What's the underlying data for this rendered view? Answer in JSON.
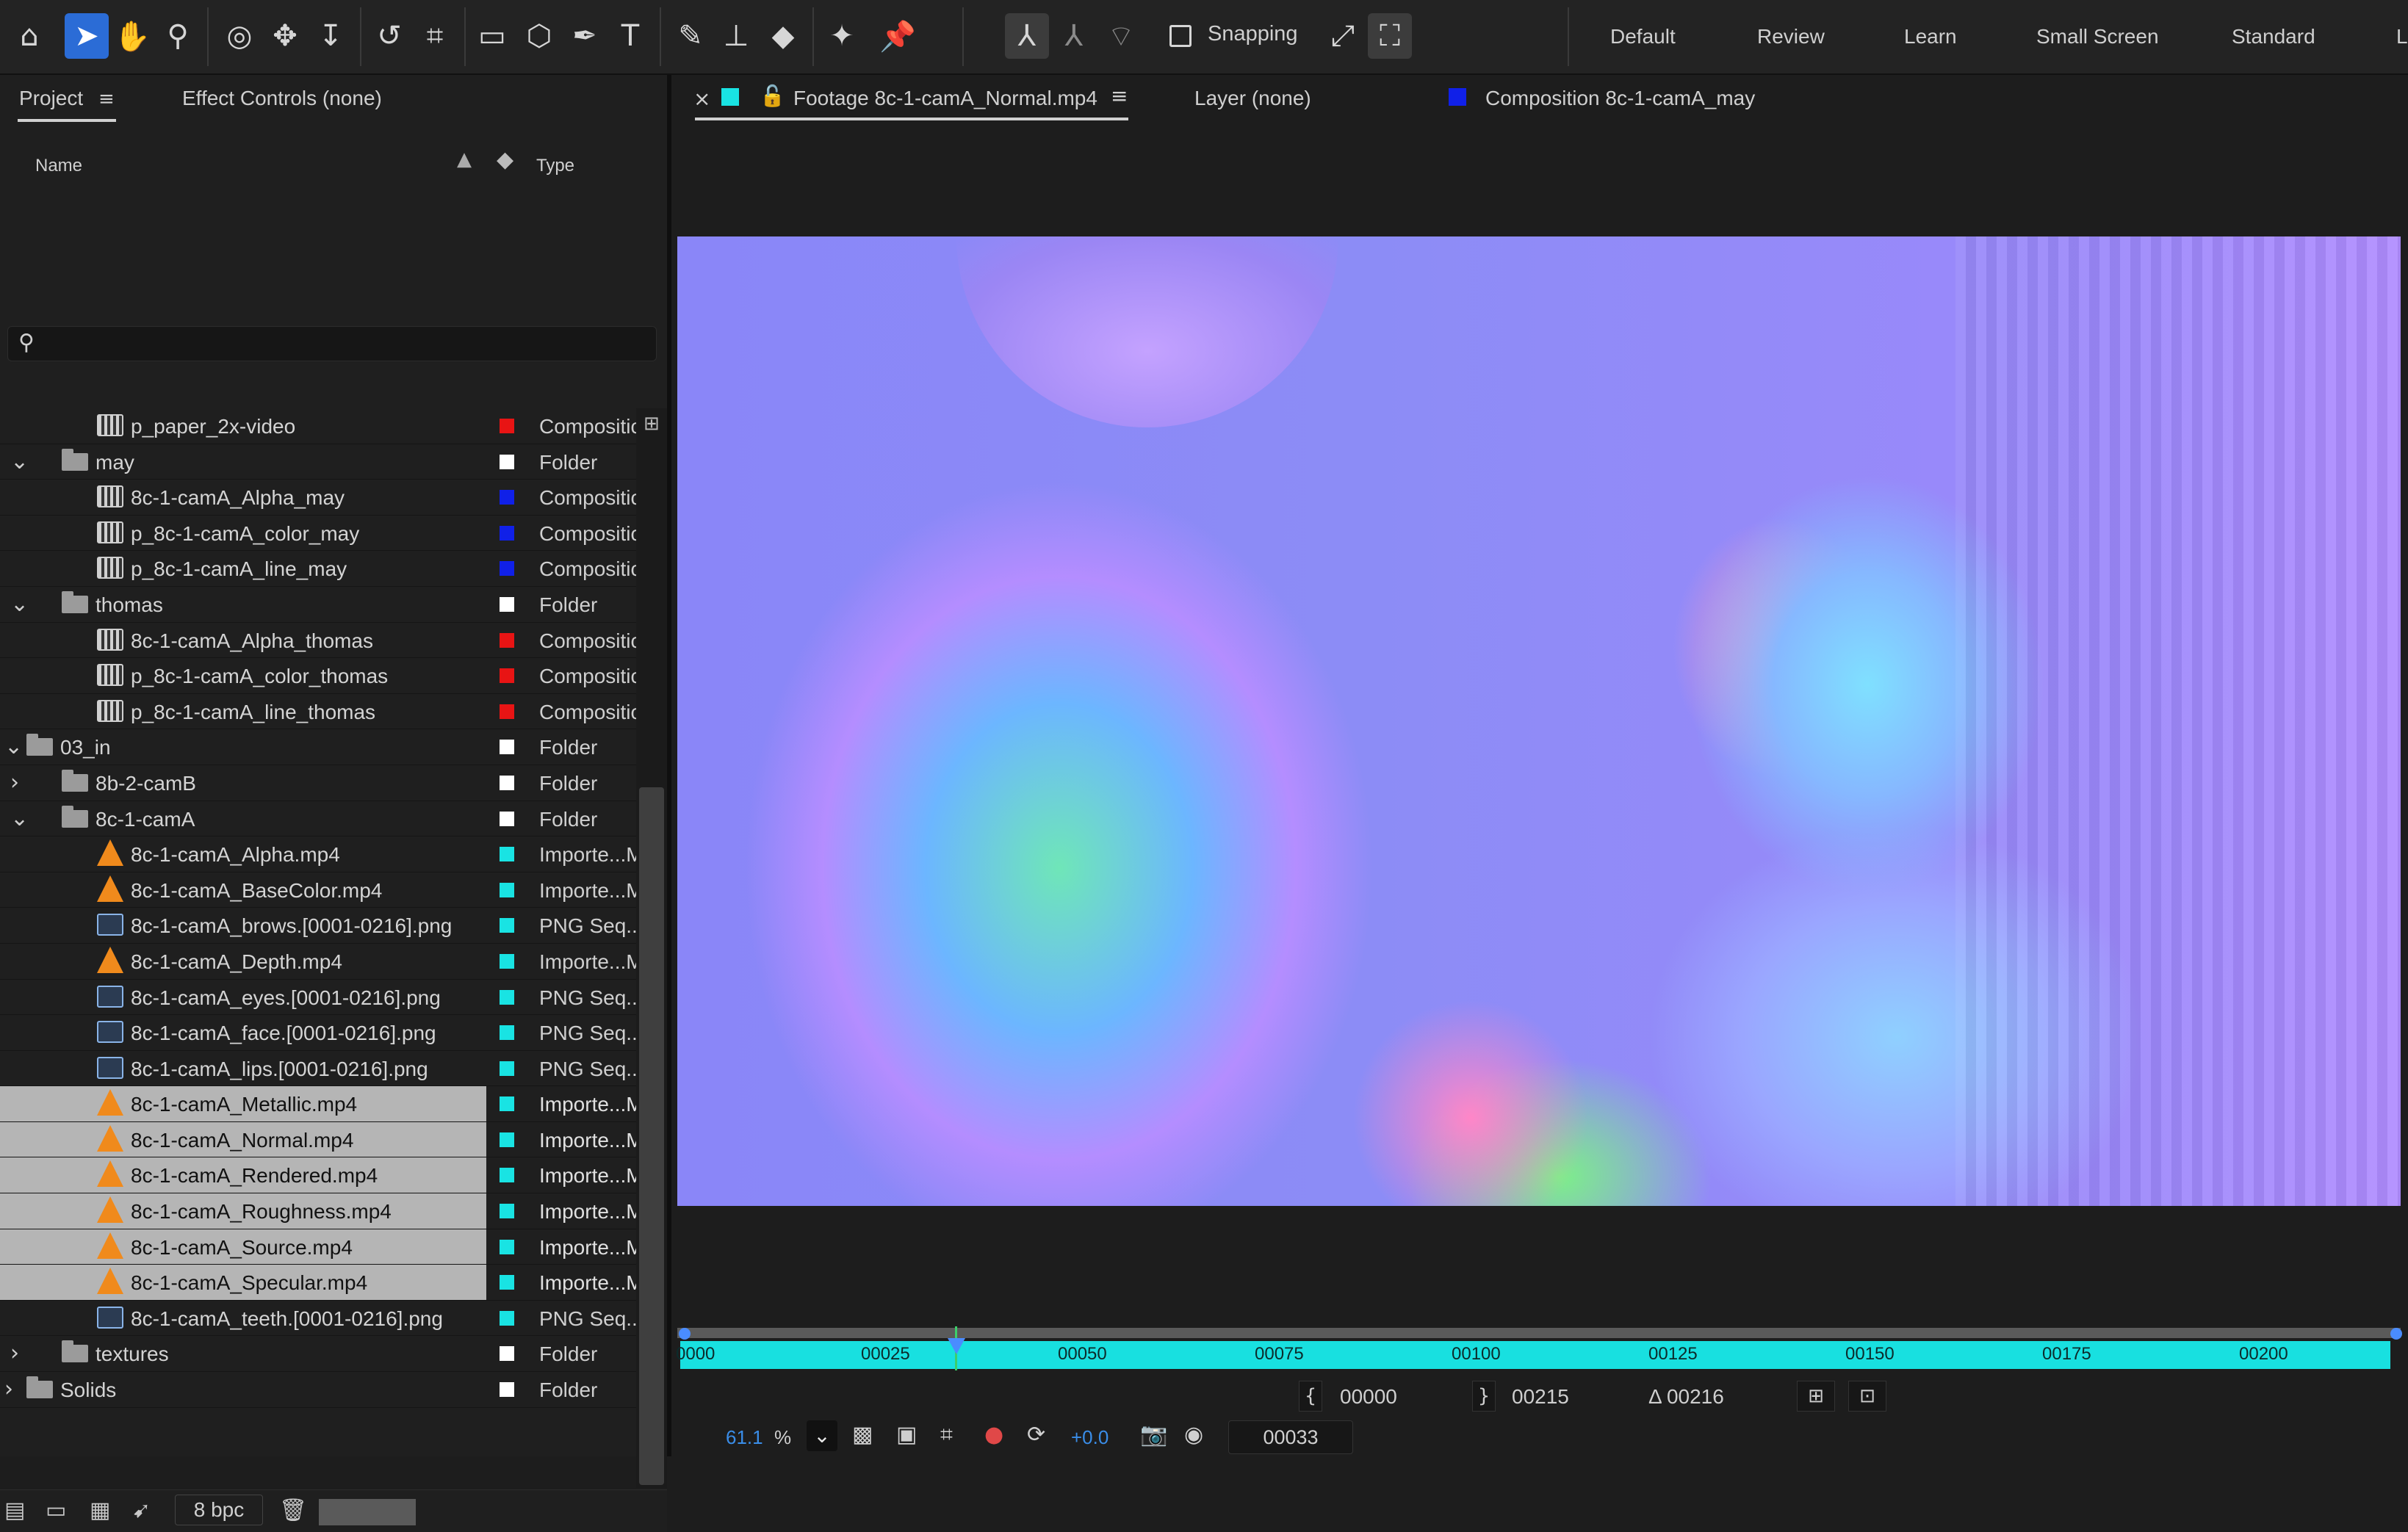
{
  "toolbar": {
    "icons": [
      "home-icon",
      "selection-tool-icon",
      "hand-tool-icon",
      "zoom-tool-icon",
      "orbit-tool-icon",
      "pan-tool-icon",
      "dolly-tool-icon",
      "rotate-tool-icon",
      "pan-behind-tool-icon",
      "rectangle-tool-icon",
      "shape-3d-icon",
      "pen-tool-icon",
      "type-tool-icon",
      "brush-tool-icon",
      "clone-stamp-icon",
      "eraser-tool-icon",
      "roto-brush-icon",
      "puppet-pin-icon"
    ],
    "snapping_label": "Snapping",
    "workspaces": [
      "Default",
      "Review",
      "Learn",
      "Small Screen",
      "Standard",
      "Li"
    ]
  },
  "left_panel": {
    "tabs": [
      "Project",
      "Effect Controls (none)"
    ],
    "search_placeholder": "",
    "columns": {
      "name": "Name",
      "type": "Type"
    },
    "bpc": "8 bpc"
  },
  "colors": {
    "red": "#e81414",
    "white": "#ffffff",
    "blue": "#1020e8",
    "cyan": "#19e3e3",
    "selection": "#b5b5b5",
    "accent": "#2b6cd6"
  },
  "project_rows": [
    {
      "name": "p_paper_2x-video",
      "type": "Compositic",
      "icon": "composition-icon",
      "indent": 2,
      "color": "red",
      "chevron": ""
    },
    {
      "name": "may",
      "type": "Folder",
      "icon": "folder-icon",
      "indent": 1,
      "color": "white",
      "chevron": "open"
    },
    {
      "name": "8c-1-camA_Alpha_may",
      "type": "Compositic",
      "icon": "composition-icon",
      "indent": 2,
      "color": "blue",
      "chevron": ""
    },
    {
      "name": "p_8c-1-camA_color_may",
      "type": "Compositic",
      "icon": "composition-icon",
      "indent": 2,
      "color": "blue",
      "chevron": ""
    },
    {
      "name": "p_8c-1-camA_line_may",
      "type": "Compositic",
      "icon": "composition-icon",
      "indent": 2,
      "color": "blue",
      "chevron": ""
    },
    {
      "name": "thomas",
      "type": "Folder",
      "icon": "folder-icon",
      "indent": 1,
      "color": "white",
      "chevron": "open"
    },
    {
      "name": "8c-1-camA_Alpha_thomas",
      "type": "Compositic",
      "icon": "composition-icon",
      "indent": 2,
      "color": "red",
      "chevron": ""
    },
    {
      "name": "p_8c-1-camA_color_thomas",
      "type": "Compositic",
      "icon": "composition-icon",
      "indent": 2,
      "color": "red",
      "chevron": ""
    },
    {
      "name": "p_8c-1-camA_line_thomas",
      "type": "Compositic",
      "icon": "composition-icon",
      "indent": 2,
      "color": "red",
      "chevron": ""
    },
    {
      "name": "03_in",
      "type": "Folder",
      "icon": "folder-icon",
      "indent": 0,
      "color": "white",
      "chevron": "open"
    },
    {
      "name": "8b-2-camB",
      "type": "Folder",
      "icon": "folder-icon",
      "indent": 1,
      "color": "white",
      "chevron": "closed"
    },
    {
      "name": "8c-1-camA",
      "type": "Folder",
      "icon": "folder-icon",
      "indent": 1,
      "color": "white",
      "chevron": "open"
    },
    {
      "name": "8c-1-camA_Alpha.mp4",
      "type": "Importe...M",
      "icon": "video-file-icon",
      "indent": 2,
      "color": "cyan",
      "chevron": ""
    },
    {
      "name": "8c-1-camA_BaseColor.mp4",
      "type": "Importe...M",
      "icon": "video-file-icon",
      "indent": 2,
      "color": "cyan",
      "chevron": ""
    },
    {
      "name": "8c-1-camA_brows.[0001-0216].png",
      "type": "PNG Seq...e",
      "icon": "image-sequence-icon",
      "indent": 2,
      "color": "cyan",
      "chevron": ""
    },
    {
      "name": "8c-1-camA_Depth.mp4",
      "type": "Importe...M",
      "icon": "video-file-icon",
      "indent": 2,
      "color": "cyan",
      "chevron": ""
    },
    {
      "name": "8c-1-camA_eyes.[0001-0216].png",
      "type": "PNG Seq...e",
      "icon": "image-sequence-icon",
      "indent": 2,
      "color": "cyan",
      "chevron": ""
    },
    {
      "name": "8c-1-camA_face.[0001-0216].png",
      "type": "PNG Seq...e",
      "icon": "image-sequence-icon",
      "indent": 2,
      "color": "cyan",
      "chevron": ""
    },
    {
      "name": "8c-1-camA_lips.[0001-0216].png",
      "type": "PNG Seq...e",
      "icon": "image-sequence-icon",
      "indent": 2,
      "color": "cyan",
      "chevron": ""
    },
    {
      "name": "8c-1-camA_Metallic.mp4",
      "type": "Importe...M",
      "icon": "video-file-icon",
      "indent": 2,
      "color": "cyan",
      "chevron": "",
      "selected": true
    },
    {
      "name": "8c-1-camA_Normal.mp4",
      "type": "Importe...M",
      "icon": "video-file-icon",
      "indent": 2,
      "color": "cyan",
      "chevron": "",
      "selected": true
    },
    {
      "name": "8c-1-camA_Rendered.mp4",
      "type": "Importe...M",
      "icon": "video-file-icon",
      "indent": 2,
      "color": "cyan",
      "chevron": "",
      "selected": true
    },
    {
      "name": "8c-1-camA_Roughness.mp4",
      "type": "Importe...M",
      "icon": "video-file-icon",
      "indent": 2,
      "color": "cyan",
      "chevron": "",
      "selected": true
    },
    {
      "name": "8c-1-camA_Source.mp4",
      "type": "Importe...M",
      "icon": "video-file-icon",
      "indent": 2,
      "color": "cyan",
      "chevron": "",
      "selected": true
    },
    {
      "name": "8c-1-camA_Specular.mp4",
      "type": "Importe...M",
      "icon": "video-file-icon",
      "indent": 2,
      "color": "cyan",
      "chevron": "",
      "selected": true
    },
    {
      "name": "8c-1-camA_teeth.[0001-0216].png",
      "type": "PNG Seq...e",
      "icon": "image-sequence-icon",
      "indent": 2,
      "color": "cyan",
      "chevron": ""
    },
    {
      "name": "textures",
      "type": "Folder",
      "icon": "folder-icon",
      "indent": 1,
      "color": "white",
      "chevron": "closed"
    },
    {
      "name": "Solids",
      "type": "Folder",
      "icon": "folder-icon",
      "indent": 0,
      "color": "white",
      "chevron": "closed"
    }
  ],
  "viewer": {
    "tabs": [
      "Footage 8c-1-camA_Normal.mp4",
      "Layer (none)",
      "Composition 8c-1-camA_may"
    ],
    "timeline_ticks": [
      "0000",
      "00025",
      "00050",
      "00075",
      "00100",
      "00125",
      "00150",
      "00175",
      "00200"
    ],
    "in_point": "00000",
    "out_point": "00215",
    "duration": "Δ 00216",
    "zoom": "61.1",
    "zoom_unit": "%",
    "exposure": "+0.0",
    "current_frame": "00033"
  }
}
